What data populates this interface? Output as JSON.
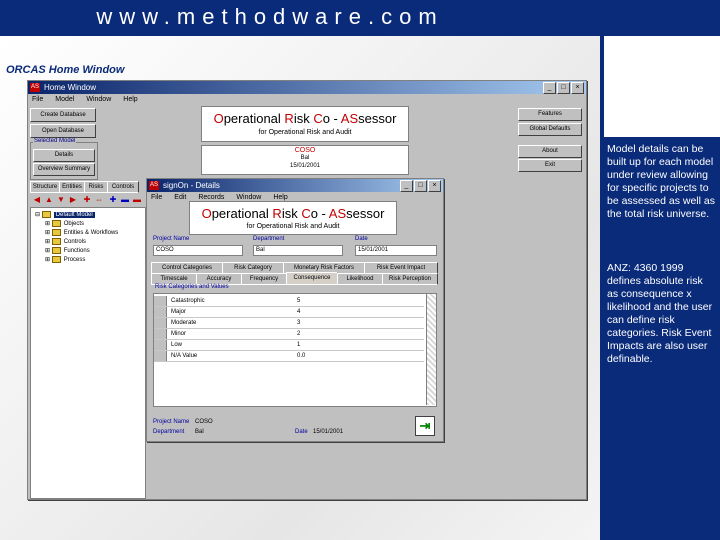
{
  "banner": {
    "title": "www.methodware.com"
  },
  "page": {
    "title": "ORCAS Home Window"
  },
  "side": {
    "para1": "Model details can be built up for each model under review allowing for specific projects to be assessed as well as the total risk universe.",
    "para2": "ANZ: 4360 1999 defines absolute risk as consequence x likelihood and the user can define risk categories. Risk Event Impacts are also user definable."
  },
  "colors": {
    "banner": "#0a2a7a",
    "accent_red": "#c00000",
    "label_blue": "#0000a0"
  },
  "home_window": {
    "title": "Home Window",
    "menu": [
      "File",
      "Model",
      "Window",
      "Help"
    ],
    "left_buttons": [
      "Create Database",
      "Open Database"
    ],
    "group_label": "Selected Model",
    "group_buttons": [
      "Details",
      "Overview Summary"
    ],
    "logo": {
      "main_parts": [
        {
          "text": "O",
          "accent": true
        },
        {
          "text": "perational ",
          "accent": false
        },
        {
          "text": "R",
          "accent": true
        },
        {
          "text": "isk ",
          "accent": false
        },
        {
          "text": "C",
          "accent": true
        },
        {
          "text": "o - ",
          "accent": false
        },
        {
          "text": "AS",
          "accent": true
        },
        {
          "text": "sessor",
          "accent": false
        }
      ],
      "sub": "for Operational Risk and Audit"
    },
    "model_box": {
      "code": "COSO",
      "line2": "Bal",
      "line3": "15/01/2001"
    },
    "right_buttons": [
      "Features",
      "Global Defaults",
      "About",
      "Exit"
    ],
    "tabs": [
      "Structure",
      "Entities",
      "Risks",
      "Controls"
    ],
    "tree_items": [
      "Default Model",
      "Objects",
      "Entities & Workflows",
      "Controls",
      "Functions",
      "Process"
    ]
  },
  "details_window": {
    "title": "signOn - Details",
    "menu": [
      "File",
      "Edit",
      "Records",
      "Window",
      "Help"
    ],
    "logo_sub": "for Operational Risk and Audit",
    "fields": [
      {
        "label": "Project Name",
        "value": "COSO"
      },
      {
        "label": "Department",
        "value": "Bal"
      },
      {
        "label": "Date",
        "value": "15/01/2001"
      }
    ],
    "tabs_row1": [
      "Control Categories",
      "Risk Category",
      "Monetary Risk Factors",
      "Risk Event Impact"
    ],
    "tabs_row2": [
      "Timescale",
      "Accuracy",
      "Frequency",
      "Consequence",
      "Likelihood",
      "Risk Perception"
    ],
    "grid_header": "Risk Categories and Values",
    "grid_rows": [
      {
        "name": "Catastrophic",
        "value": "5"
      },
      {
        "name": "Major",
        "value": "4"
      },
      {
        "name": "Moderate",
        "value": "3"
      },
      {
        "name": "Minor",
        "value": "2"
      },
      {
        "name": "Low",
        "value": "1"
      },
      {
        "name": "N/A Value",
        "value": "0.0"
      }
    ],
    "footer": {
      "project_label": "Project Name",
      "project_value": "COSO",
      "dept_label": "Department",
      "dept_value": "Bal",
      "date_label": "Date",
      "date_value": "15/01/2001"
    }
  }
}
